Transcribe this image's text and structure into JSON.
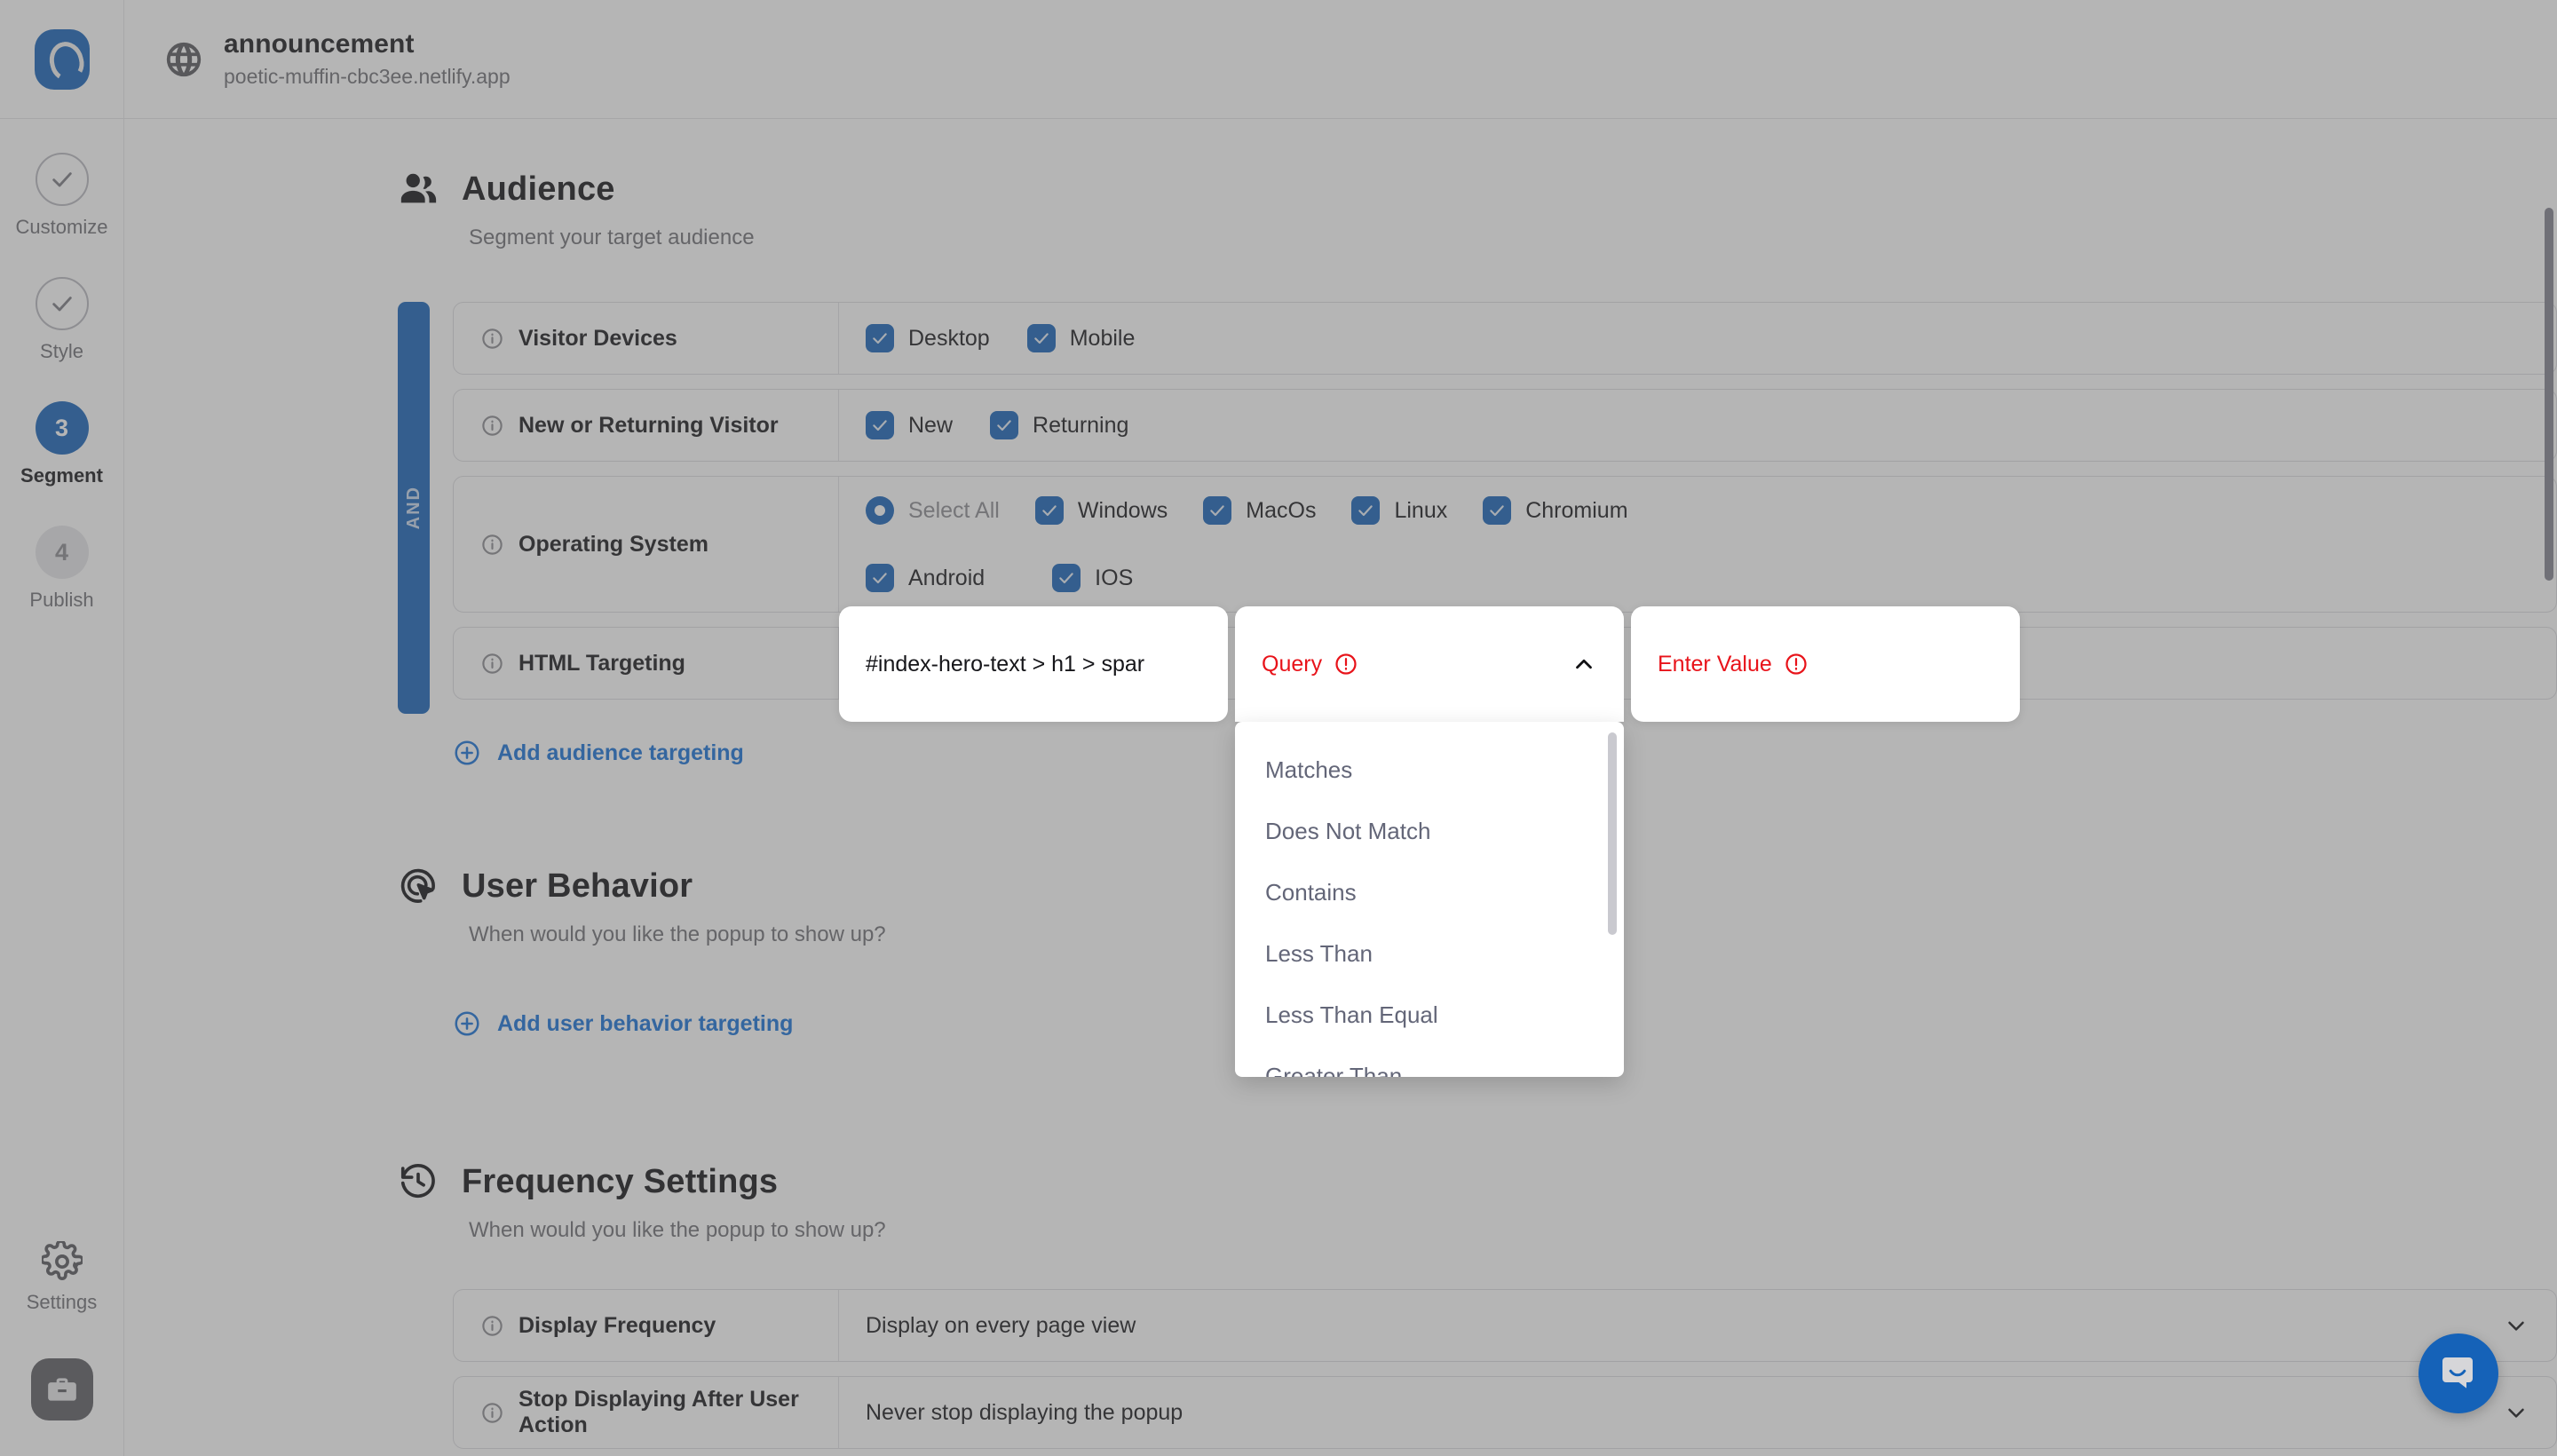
{
  "header": {
    "site_name": "announcement",
    "site_url": "poetic-muffin-cbc3ee.netlify.app",
    "globe_icon": "globe-icon",
    "logo_icon": "app-logo-icon"
  },
  "rail": {
    "items": [
      {
        "badge": "✓",
        "label": "Customize",
        "state": "done"
      },
      {
        "badge": "✓",
        "label": "Style",
        "state": "done"
      },
      {
        "badge": "3",
        "label": "Segment",
        "state": "active"
      },
      {
        "badge": "4",
        "label": "Publish",
        "state": "todo"
      }
    ],
    "settings_label": "Settings",
    "settings_icon": "gear-icon",
    "briefcase_icon": "briefcase-icon"
  },
  "audience": {
    "icon": "users-icon",
    "title": "Audience",
    "subtitle": "Segment your target audience",
    "and_label": "AND",
    "add_link": "Add audience targeting",
    "rows": [
      {
        "label": "Visitor Devices",
        "type": "checkboxes",
        "options": [
          {
            "label": "Desktop",
            "checked": true
          },
          {
            "label": "Mobile",
            "checked": true
          }
        ]
      },
      {
        "label": "New or Returning Visitor",
        "type": "checkboxes",
        "options": [
          {
            "label": "New",
            "checked": true
          },
          {
            "label": "Returning",
            "checked": true
          }
        ]
      },
      {
        "label": "Operating System",
        "type": "checkboxes",
        "options": [
          {
            "label": "Select All",
            "checked": true,
            "control": "radio",
            "muted": true
          },
          {
            "label": "Windows",
            "checked": true
          },
          {
            "label": "MacOs",
            "checked": true
          },
          {
            "label": "Linux",
            "checked": true
          },
          {
            "label": "Chromium",
            "checked": true
          },
          {
            "label": "Android",
            "checked": true
          },
          {
            "label": "IOS",
            "checked": true
          }
        ]
      },
      {
        "label": "HTML Targeting",
        "type": "html-targeting"
      }
    ]
  },
  "html_targeting": {
    "selector_value": "#index-hero-text > h1 > spar",
    "query_label": "Query",
    "query_error": true,
    "value_label": "Enter Value",
    "value_error": true,
    "chevron_icon": "chevron-up-icon",
    "error_icon": "exclamation-circle-icon",
    "dropdown_open": true,
    "dropdown_options": [
      "Matches",
      "Does Not Match",
      "Contains",
      "Less Than",
      "Less Than Equal",
      "Greater Than"
    ]
  },
  "user_behavior": {
    "icon": "cursor-target-icon",
    "title": "User Behavior",
    "subtitle": "When would you like the popup to show up?",
    "add_link": "Add user behavior targeting"
  },
  "frequency": {
    "icon": "history-icon",
    "title": "Frequency Settings",
    "subtitle": "When would you like the popup to show up?",
    "rows": [
      {
        "label": "Display Frequency",
        "value": "Display on every page view"
      },
      {
        "label": "Stop Displaying After User Action",
        "value": "Never stop displaying the popup"
      }
    ]
  },
  "widgets": {
    "intercom_icon": "chat-bubble-icon"
  },
  "colors": {
    "brand_blue": "#1562b8",
    "link_blue": "#1570d8",
    "error_red": "#e8131a",
    "muted_gray": "#6d6d74"
  }
}
